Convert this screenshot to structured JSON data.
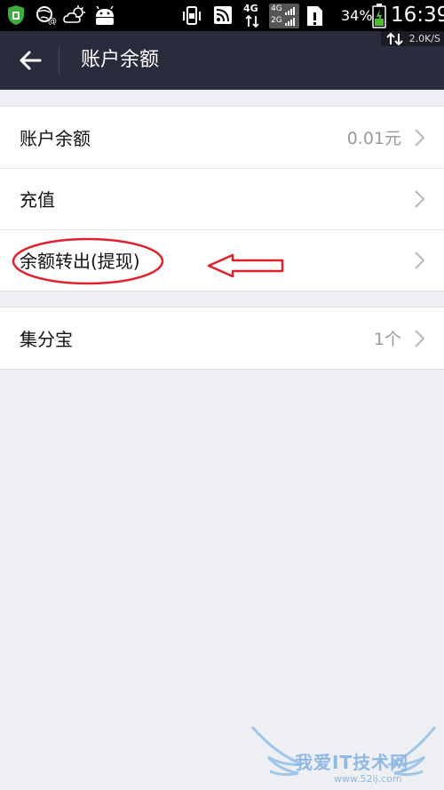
{
  "status_bar": {
    "network_4g": "4G",
    "network_4g_small": "4G",
    "network_2g_small": "2G",
    "battery_percent": "34%",
    "time": "16:39"
  },
  "header": {
    "title": "账户余额",
    "net_speed": "2.0K/S"
  },
  "list_main": [
    {
      "label": "账户余额",
      "value": "0.01元"
    },
    {
      "label": "充值",
      "value": ""
    },
    {
      "label": "余额转出(提现)",
      "value": ""
    }
  ],
  "list_secondary": [
    {
      "label": "集分宝",
      "value": "1个"
    }
  ],
  "watermark": {
    "text": "我爱IT技术网",
    "url": "www.52ij.com"
  },
  "colors": {
    "header_bg": "#2a2c3d",
    "page_bg": "#eeeff2",
    "annotation_red": "#e0202a"
  }
}
